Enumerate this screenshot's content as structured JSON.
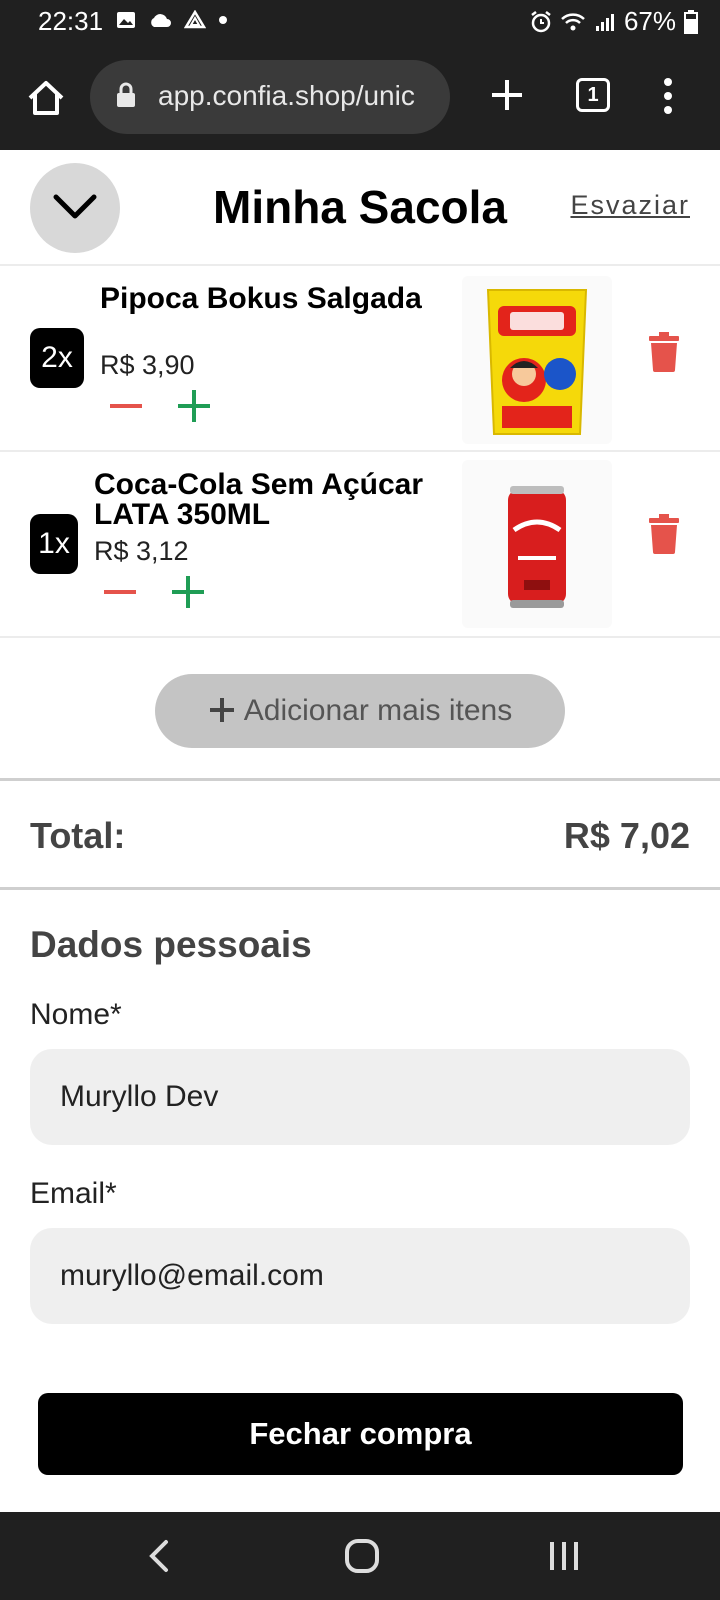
{
  "status_bar": {
    "time": "22:31",
    "battery": "67%"
  },
  "browser": {
    "url": "app.confia.shop/unic",
    "tab_count": "1"
  },
  "header": {
    "title": "Minha Sacola",
    "empty_label": "Esvaziar"
  },
  "cart": {
    "items": [
      {
        "qty": "2x",
        "name": "Pipoca Bokus Salgada",
        "price": "R$ 3,90",
        "image": "popcorn-bag"
      },
      {
        "qty": "1x",
        "name": "Coca-Cola Sem Açúcar LATA 350ML",
        "price": "R$ 3,12",
        "image": "soda-can"
      }
    ],
    "add_more_label": "Adicionar mais itens"
  },
  "total": {
    "label": "Total:",
    "value": "R$ 7,02"
  },
  "form": {
    "section_title": "Dados pessoais",
    "name_label": "Nome*",
    "name_value": "Muryllo Dev",
    "email_label": "Email*",
    "email_value": "muryllo@email.com"
  },
  "checkout": {
    "label": "Fechar compra"
  },
  "colors": {
    "accent_red": "#e5534b",
    "accent_green": "#1f9d55",
    "dark_bar": "#202020"
  }
}
